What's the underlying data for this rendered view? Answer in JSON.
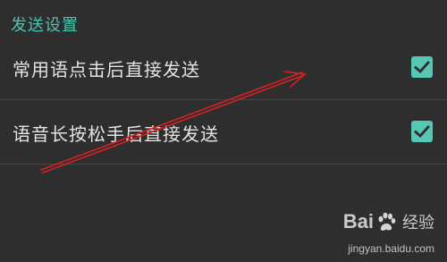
{
  "section": {
    "title": "发送设置"
  },
  "preferences": [
    {
      "label": "常用语点击后直接发送",
      "checked": true
    },
    {
      "label": "语音长按松手后直接发送",
      "checked": true
    }
  ],
  "annotation": {
    "type": "red-arrow",
    "color": "#d32222"
  },
  "watermark": {
    "brand_left": "Bai",
    "brand_right": "经验",
    "url": "jingyan.baidu.com"
  },
  "colors": {
    "background": "#2e2e2e",
    "accent": "#4fc2b0",
    "checkbox": "#58c6b4",
    "text": "#e4e4e4",
    "divider": "#454545"
  }
}
